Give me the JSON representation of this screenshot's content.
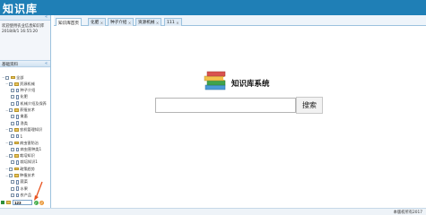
{
  "app": {
    "title": "知识库"
  },
  "left_panel": {
    "welcome_line1": "欢迎使用农业信息知识库",
    "welcome_line2": "2018/8/1 16:55:20",
    "section_title": "基础资料",
    "tree": [
      {
        "label": "全部",
        "level": 0,
        "type": "root"
      },
      {
        "label": "资源机械",
        "level": 1,
        "type": "folder"
      },
      {
        "label": "种子介绍",
        "level": 2,
        "type": "file"
      },
      {
        "label": "化肥",
        "level": 2,
        "type": "file"
      },
      {
        "label": "机械介绍及保养",
        "level": 2,
        "type": "file"
      },
      {
        "label": "养殖技术",
        "level": 1,
        "type": "folder"
      },
      {
        "label": "禽畜",
        "level": 2,
        "type": "file"
      },
      {
        "label": "渔类",
        "level": 2,
        "type": "file"
      },
      {
        "label": "农机管理知识",
        "level": 1,
        "type": "folder"
      },
      {
        "label": "1",
        "level": 2,
        "type": "file"
      },
      {
        "label": "病虫害防治",
        "level": 1,
        "type": "folder"
      },
      {
        "label": "病虫害种类1",
        "level": 2,
        "type": "file"
      },
      {
        "label": "栽培知识",
        "level": 1,
        "type": "folder"
      },
      {
        "label": "栽培知识1",
        "level": 2,
        "type": "file"
      },
      {
        "label": "政策趋势",
        "level": 1,
        "type": "folder"
      },
      {
        "label": "种植技术",
        "level": 1,
        "type": "folder"
      },
      {
        "label": "蔬菜",
        "level": 2,
        "type": "file"
      },
      {
        "label": "水果",
        "level": 2,
        "type": "file"
      },
      {
        "label": "农产品",
        "level": 2,
        "type": "file"
      }
    ],
    "edit_value": "123"
  },
  "tabs": [
    {
      "label": "知识库首页",
      "closable": false
    },
    {
      "label": "化肥",
      "closable": true
    },
    {
      "label": "种子介绍",
      "closable": true
    },
    {
      "label": "资源机械",
      "closable": true
    },
    {
      "label": "111",
      "closable": true
    }
  ],
  "main": {
    "brand_text": "知识库系统",
    "search_value": "",
    "search_button": "搜索"
  },
  "footer": {
    "copyright": "本版权所有2017"
  },
  "colors": {
    "header": "#1f7fb6",
    "accent": "#9cc2de",
    "arrow": "#e8531f"
  }
}
